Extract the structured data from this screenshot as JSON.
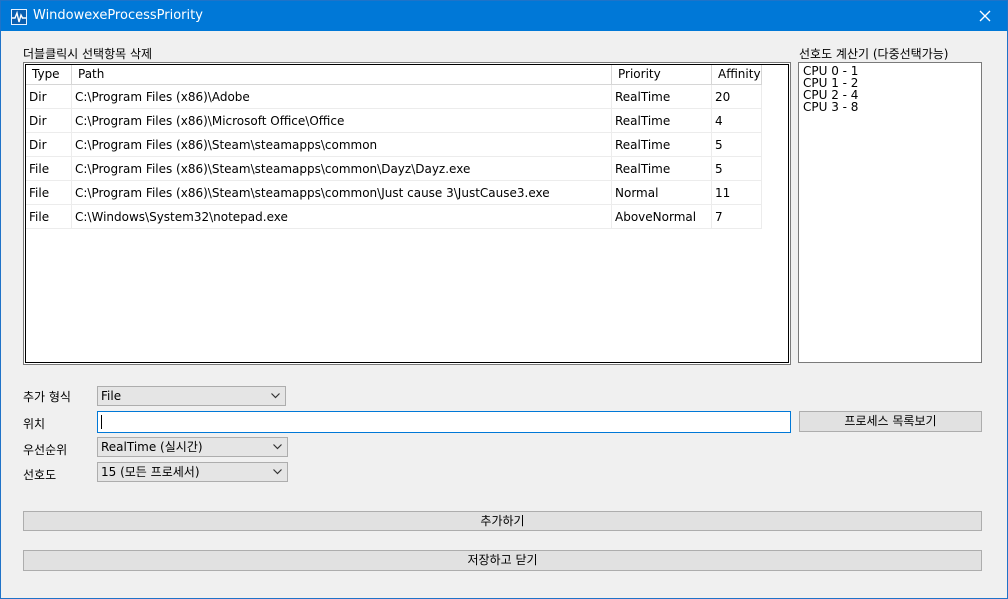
{
  "window": {
    "title": "WindowexeProcessPriority"
  },
  "list": {
    "caption": "더블클릭시 선택항목 삭제",
    "columns": [
      "Type",
      "Path",
      "Priority",
      "Affinity"
    ],
    "rows": [
      {
        "type": "Dir",
        "path": "C:\\Program Files (x86)\\Adobe",
        "priority": "RealTime",
        "affinity": "20"
      },
      {
        "type": "Dir",
        "path": "C:\\Program Files (x86)\\Microsoft Office\\Office",
        "priority": "RealTime",
        "affinity": "4"
      },
      {
        "type": "Dir",
        "path": "C:\\Program Files (x86)\\Steam\\steamapps\\common",
        "priority": "RealTime",
        "affinity": "5"
      },
      {
        "type": "File",
        "path": "C:\\Program Files (x86)\\Steam\\steamapps\\common\\Dayz\\Dayz.exe",
        "priority": "RealTime",
        "affinity": "5"
      },
      {
        "type": "File",
        "path": "C:\\Program Files (x86)\\Steam\\steamapps\\common\\Just cause 3\\JustCause3.exe",
        "priority": "Normal",
        "affinity": "11"
      },
      {
        "type": "File",
        "path": "C:\\Windows\\System32\\notepad.exe",
        "priority": "AboveNormal",
        "affinity": "7"
      }
    ]
  },
  "calculator": {
    "caption": "선호도 계산기 (다중선택가능)",
    "items": [
      "CPU 0 - 1",
      "CPU 1 - 2",
      "CPU 2 - 4",
      "CPU 3 - 8"
    ]
  },
  "form": {
    "type_label": "추가 형식",
    "type_value": "File",
    "location_label": "위치",
    "location_value": "",
    "browse_button": "프로세스 목록보기",
    "priority_label": "우선순위",
    "priority_value": "RealTime (실시간)",
    "affinity_label": "선호도",
    "affinity_value": "15 (모든 프로세서)"
  },
  "buttons": {
    "add": "추가하기",
    "save_close": "저장하고 닫기"
  },
  "colors": {
    "titlebar": "#0078d7",
    "background": "#f0f0f0",
    "focus": "#0078d7"
  },
  "icons": {
    "app": "pulse-icon",
    "close": "close-icon",
    "dropdown": "chevron-down-icon"
  }
}
